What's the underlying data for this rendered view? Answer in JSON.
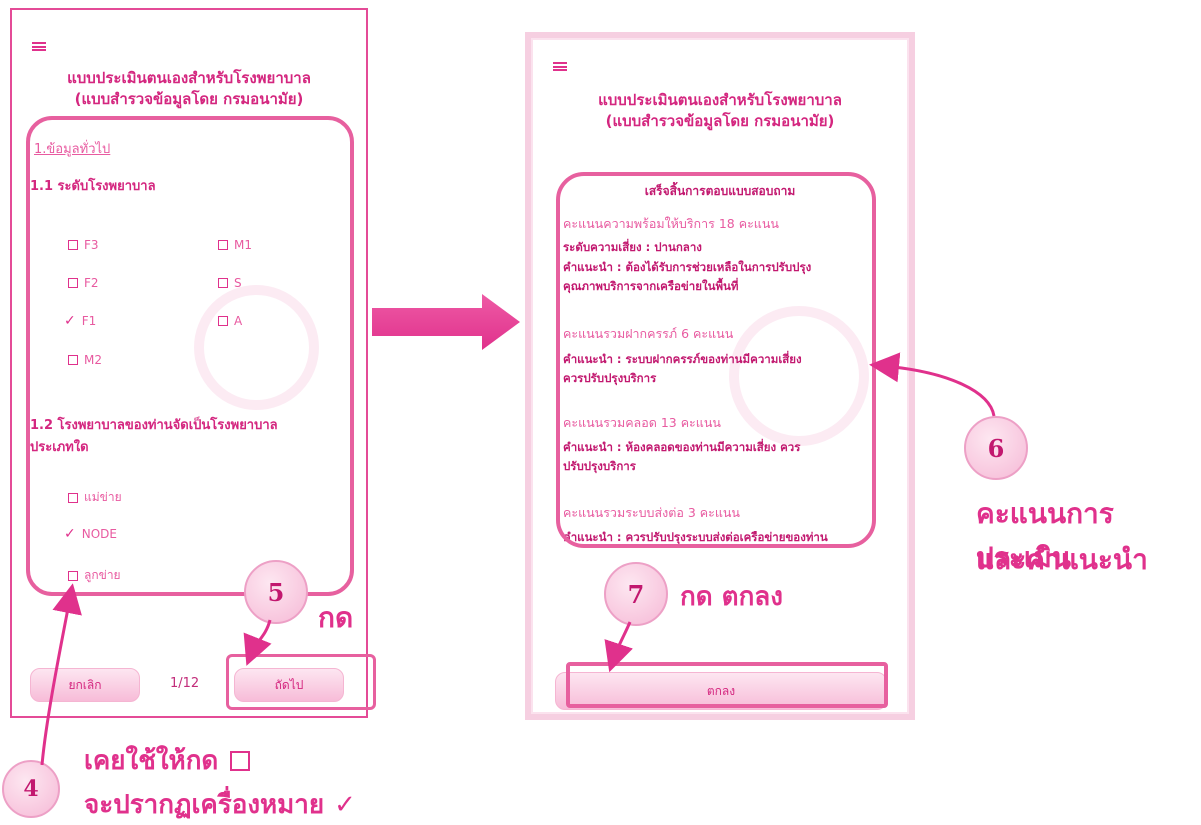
{
  "left_screen": {
    "title_line1": "แบบประเมินตนเองสำหรับโรงพยาบาล",
    "title_line2": "(แบบสำรวจข้อมูลโดย กรมอนามัย)",
    "section_general": "1.ข้อมูลทั่วไป",
    "q1_label": "1.1 ระดับโรงพยาบาล",
    "q1_options": [
      {
        "label": "F3",
        "checked": false
      },
      {
        "label": "M1",
        "checked": false
      },
      {
        "label": "F2",
        "checked": false
      },
      {
        "label": "S",
        "checked": false
      },
      {
        "label": "F1",
        "checked": true
      },
      {
        "label": "A",
        "checked": false
      },
      {
        "label": "M2",
        "checked": false
      }
    ],
    "q2_label_line1": "1.2 โรงพยาบาลของท่านจัดเป็นโรงพยาบาล",
    "q2_label_line2": "ประเภทใด",
    "q2_options": [
      {
        "label": "แม่ข่าย",
        "checked": false
      },
      {
        "label": "NODE",
        "checked": true
      },
      {
        "label": "ลูกข่าย",
        "checked": false
      }
    ],
    "cancel_label": "ยกเลิก",
    "page_indicator": "1/12",
    "next_label": "ถัดไป"
  },
  "right_screen": {
    "title_line1": "แบบประเมินตนเองสำหรับโรงพยาบาล",
    "title_line2": "(แบบสำรวจข้อมูลโดย กรมอนามัย)",
    "complete_heading": "เสร็จสิ้นการตอบแบบสอบถาม",
    "readiness_score": "คะแนนความพร้อมให้บริการ 18 คะแนน",
    "risk_level": "ระดับความเสี่ยง : ปานกลาง",
    "advice1_line1": "คำแนะนำ : ต้องได้รับการช่วยเหลือในการปรับปรุง",
    "advice1_line2": "คุณภาพบริการจากเครือข่ายในพื้นที่",
    "anc_score": "คะแนนรวมฝากครรภ์ 6 คะแนน",
    "advice2_line1": "คำแนะนำ : ระบบฝากครรภ์ของท่านมีความเสี่ยง",
    "advice2_line2": "ควรปรับปรุงบริการ",
    "delivery_score": "คะแนนรวมคลอด 13 คะแนน",
    "advice3_line1": "คำแนะนำ : ห้องคลอดของท่านมีความเสี่ยง ควร",
    "advice3_line2": "ปรับปรุงบริการ",
    "referral_score": "คะแนนรวมระบบส่งต่อ 3 คะแนน",
    "advice4_line1": "คำแนะนำ : ควรปรับปรุงระบบส่งต่อเครือข่ายของท่าน",
    "ok_label": "ตกลง"
  },
  "annotations": {
    "step4": "4",
    "step5": "5",
    "step6": "6",
    "step7": "7",
    "press": "กด",
    "press_ok": "กด ตกลง",
    "score_line1": "คะแนนการประเมิน",
    "score_line2": "และคำแนะนำ",
    "hint_line1": "เคยใช้ให้กด",
    "hint_line2": "จะปรากฏเครื่องหมาย"
  },
  "colors": {
    "accent": "#e0318c",
    "soft": "#f6b9d6"
  },
  "icons": [
    "menu-icon",
    "checkbox-icon",
    "checkmark-icon",
    "arrow-right-icon",
    "ministry-seal-watermark"
  ]
}
